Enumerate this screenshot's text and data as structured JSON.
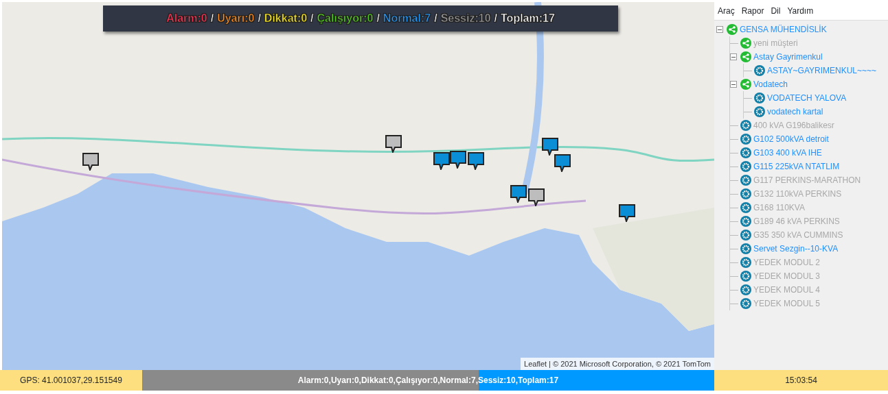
{
  "status_banner": {
    "separator": "/",
    "counters": [
      {
        "label": "Alarm:0",
        "color": "#ff3355"
      },
      {
        "label": "Uyarı:0",
        "color": "#ff8c1a"
      },
      {
        "label": "Dikkat:0",
        "color": "#ffee22"
      },
      {
        "label": "Çalışıyor:0",
        "color": "#55cc22"
      },
      {
        "label": "Normal:7",
        "color": "#2299ff"
      },
      {
        "label": "Sessiz:10",
        "color": "#999999"
      },
      {
        "label": "Toplam:17",
        "color": "#ffffff"
      }
    ]
  },
  "map": {
    "attribution": {
      "link": "Leaflet",
      "text": "| © 2021 Microsoft Corporation, © 2021 TomTom"
    },
    "markers": [
      {
        "color": "#bdbdbd"
      },
      {
        "color": "#bdbdbd"
      },
      {
        "color": "#0a8fd6"
      },
      {
        "color": "#0a8fd6"
      },
      {
        "color": "#0a8fd6"
      },
      {
        "color": "#0a8fd6"
      },
      {
        "color": "#0a8fd6"
      },
      {
        "color": "#0a8fd6"
      },
      {
        "color": "#bdbdbd"
      },
      {
        "color": "#0a8fd6"
      }
    ]
  },
  "menu": [
    "Araç",
    "Rapor",
    "Dil",
    "Yardım"
  ],
  "tree": [
    {
      "label": "GENSA MÜHENDİSLİK",
      "kind": "group",
      "online": true,
      "expanded": true,
      "children": [
        {
          "label": "yeni müşteri",
          "kind": "group",
          "online": false
        },
        {
          "label": "Astay Gayrimenkul",
          "kind": "group",
          "online": true,
          "expanded": true,
          "children": [
            {
              "label": "ASTAY~GAYRIMENKUL~~~~",
              "kind": "device",
              "online": true
            }
          ]
        },
        {
          "label": "Vodatech",
          "kind": "group",
          "online": true,
          "expanded": true,
          "children": [
            {
              "label": "VODATECH YALOVA",
              "kind": "device",
              "online": true
            },
            {
              "label": "vodatech kartal",
              "kind": "device",
              "online": true
            }
          ]
        },
        {
          "label": "400 kVA G196balikesr",
          "kind": "device",
          "online": false
        },
        {
          "label": "G102 500kVA detroit",
          "kind": "device",
          "online": true
        },
        {
          "label": "G103 400 kVA IHE",
          "kind": "device",
          "online": true
        },
        {
          "label": "G115 225kVA NTATLIM",
          "kind": "device",
          "online": true
        },
        {
          "label": "G117 PERKINS-MARATHON",
          "kind": "device",
          "online": false
        },
        {
          "label": "G132 110kVA PERKINS",
          "kind": "device",
          "online": false
        },
        {
          "label": "G168 110KVA",
          "kind": "device",
          "online": false
        },
        {
          "label": "G189 46 kVA PERKINS",
          "kind": "device",
          "online": false
        },
        {
          "label": "G35 350 kVA CUMMINS",
          "kind": "device",
          "online": false
        },
        {
          "label": "Servet Sezgin--10-KVA",
          "kind": "device",
          "online": true
        },
        {
          "label": "YEDEK MODUL 2",
          "kind": "device",
          "online": false
        },
        {
          "label": "YEDEK MODUL 3",
          "kind": "device",
          "online": false
        },
        {
          "label": "YEDEK MODUL 4",
          "kind": "device",
          "online": false
        },
        {
          "label": "YEDEK MODUL 5",
          "kind": "device",
          "online": false
        }
      ]
    }
  ],
  "footer": {
    "gps": "GPS: 41.001037,29.151549",
    "summary": {
      "text": "Alarm:0,Uyarı:0,Dikkat:0,Çalışıyor:0,Normal:7,Sessiz:10,Toplam:17",
      "level": 0.588
    },
    "time": "15:03:54"
  }
}
